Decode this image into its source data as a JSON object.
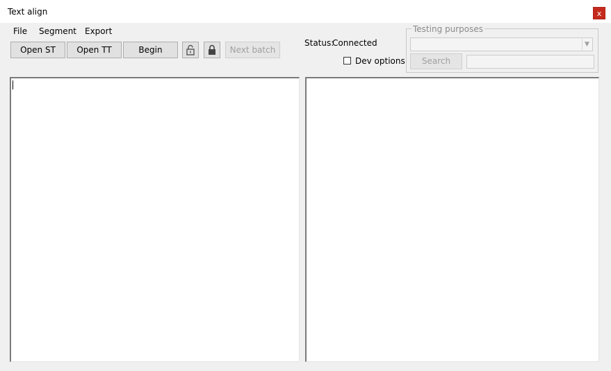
{
  "window": {
    "title": "Text align",
    "close_label": "x"
  },
  "menu": {
    "items": [
      "File",
      "Segment",
      "Export"
    ]
  },
  "toolbar": {
    "open_st": "Open ST",
    "open_tt": "Open TT",
    "begin": "Begin",
    "next_batch": "Next batch",
    "unlock_icon": "unlock-icon",
    "lock_icon": "lock-icon"
  },
  "status": {
    "label": "Status:",
    "value": "Connected"
  },
  "dev_options": {
    "label": "Dev options",
    "checked": false
  },
  "testing": {
    "legend": "Testing purposes",
    "combo_value": "",
    "search_button": "Search",
    "search_value": ""
  },
  "editors": {
    "source_text": "",
    "target_text": ""
  },
  "colors": {
    "close_button": "#c42b1c",
    "window_bg": "#f0f0f0"
  }
}
